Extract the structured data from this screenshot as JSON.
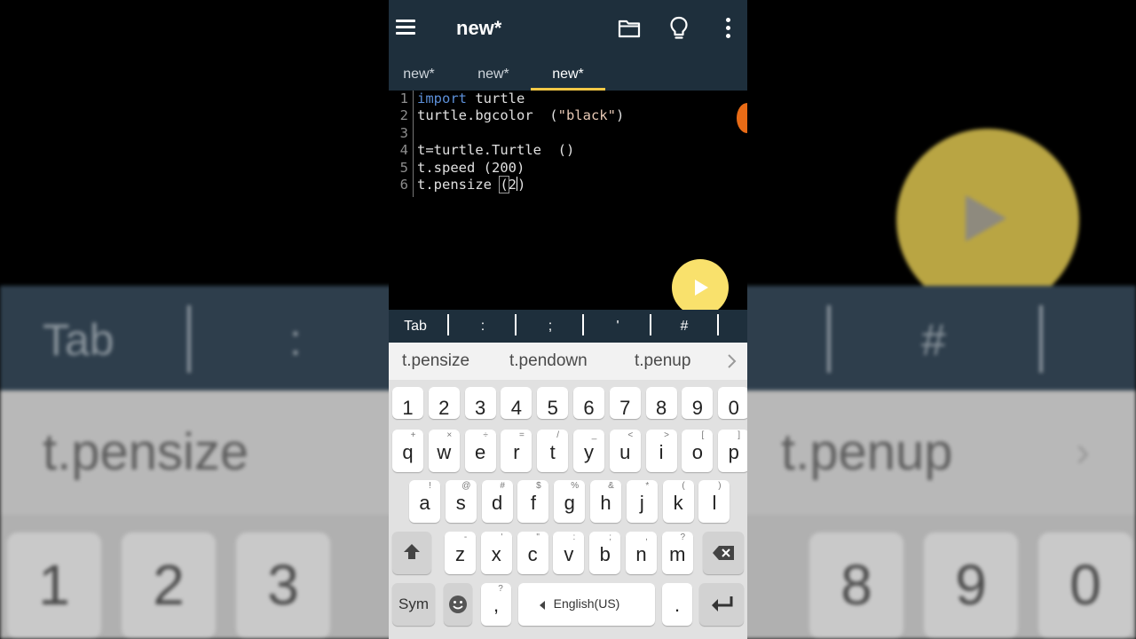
{
  "app": {
    "title": "new*",
    "tabs": [
      {
        "label": "new*"
      },
      {
        "label": "new*"
      },
      {
        "label": "new*"
      }
    ]
  },
  "editor": {
    "line_numbers": [
      "1",
      "2",
      "3",
      "4",
      "5",
      "6"
    ],
    "lines": {
      "l1_kw": "import",
      "l1_rest": " turtle",
      "l2_pre": "turtle.bgcolor  (",
      "l2_str": "\"black\"",
      "l2_post": ")",
      "l3": "",
      "l4": "t=turtle.Turtle  ()",
      "l5": "t.speed (200)",
      "l6_pre": "t.pensize ",
      "l6_bracket": "(",
      "l6_arg": "2",
      "l6_post": ")"
    }
  },
  "symbol_bar": {
    "keys": [
      "Tab",
      ":",
      ";",
      "'",
      "#"
    ]
  },
  "suggestions": {
    "items": [
      "t.pensize",
      "t.pendown",
      "t.penup"
    ]
  },
  "keyboard": {
    "numbers": [
      "1",
      "2",
      "3",
      "4",
      "5",
      "6",
      "7",
      "8",
      "9",
      "0"
    ],
    "row1": [
      {
        "key": "q",
        "alt": "+"
      },
      {
        "key": "w",
        "alt": "×"
      },
      {
        "key": "e",
        "alt": "÷"
      },
      {
        "key": "r",
        "alt": "="
      },
      {
        "key": "t",
        "alt": "/"
      },
      {
        "key": "y",
        "alt": "_"
      },
      {
        "key": "u",
        "alt": "<"
      },
      {
        "key": "i",
        "alt": ">"
      },
      {
        "key": "o",
        "alt": "["
      },
      {
        "key": "p",
        "alt": "]"
      }
    ],
    "row2": [
      {
        "key": "a",
        "alt": "!"
      },
      {
        "key": "s",
        "alt": "@"
      },
      {
        "key": "d",
        "alt": "#"
      },
      {
        "key": "f",
        "alt": "$"
      },
      {
        "key": "g",
        "alt": "%"
      },
      {
        "key": "h",
        "alt": "&"
      },
      {
        "key": "j",
        "alt": "*"
      },
      {
        "key": "k",
        "alt": "("
      },
      {
        "key": "l",
        "alt": ")"
      }
    ],
    "row3": [
      {
        "key": "z",
        "alt": "-"
      },
      {
        "key": "x",
        "alt": "'"
      },
      {
        "key": "c",
        "alt": "\""
      },
      {
        "key": "v",
        "alt": ":"
      },
      {
        "key": "b",
        "alt": ";"
      },
      {
        "key": "n",
        "alt": ","
      },
      {
        "key": "m",
        "alt": "?"
      }
    ],
    "sym_label": "Sym",
    "comma": ",",
    "comma_alt": "?",
    "space_label": "English(US)",
    "period": "."
  },
  "background_echo": {
    "tab": "Tab",
    "colon": ":",
    "hash": "#",
    "sugg_left": "t.pensize",
    "sugg_right": "t.penup",
    "keys_left": [
      "1",
      "2",
      "3"
    ],
    "keys_right": [
      "8",
      "9",
      "0"
    ]
  },
  "colors": {
    "app_bar": "#1e2f3c",
    "tab_indicator": "#f3c846",
    "fab": "#f9e16c",
    "keyword": "#5c8fd8",
    "string": "#e8c9b5"
  },
  "icons": [
    "menu-icon",
    "folder-icon",
    "lightbulb-icon",
    "more-vert-icon",
    "play-icon",
    "chevron-right-icon",
    "shift-icon",
    "backspace-icon",
    "emoji-icon",
    "enter-icon"
  ]
}
